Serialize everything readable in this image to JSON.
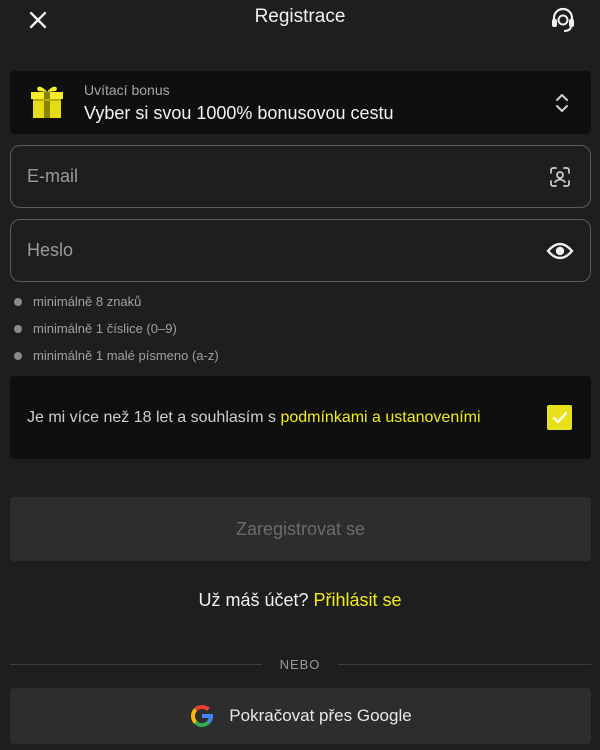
{
  "header": {
    "title": "Registrace",
    "close_icon": "close-icon",
    "support_icon": "headset-support-icon"
  },
  "bonus": {
    "icon": "gift-icon",
    "label": "Uvítací bonus",
    "value": "Vyber si svou 1000% bonusovou cestu",
    "chevron_icon": "chevron-up-down-icon"
  },
  "email": {
    "placeholder": "E-mail",
    "value": "",
    "icon": "face-scan-icon"
  },
  "password": {
    "placeholder": "Heslo",
    "value": "",
    "icon": "eye-icon"
  },
  "password_rules": [
    "minimálně 8 znaků",
    "minimálně 1 číslice (0–9)",
    "minimálně 1 malé písmeno (a-z)"
  ],
  "consent": {
    "text": "Je mi více než 18 let a souhlasím s ",
    "link": "podmínkami a ustanoveními",
    "checked": true
  },
  "register_button": "Zaregistrovat se",
  "login": {
    "question": "Už máš účet? ",
    "link": "Přihlásit se"
  },
  "divider": "NEBO",
  "google": {
    "label": "Pokračovat přes Google",
    "icon": "google-icon"
  },
  "colors": {
    "background": "#1e1e1e",
    "panel": "#0f0f0f",
    "accent": "#f2ec1a",
    "button_disabled": "#2d2d2d"
  }
}
